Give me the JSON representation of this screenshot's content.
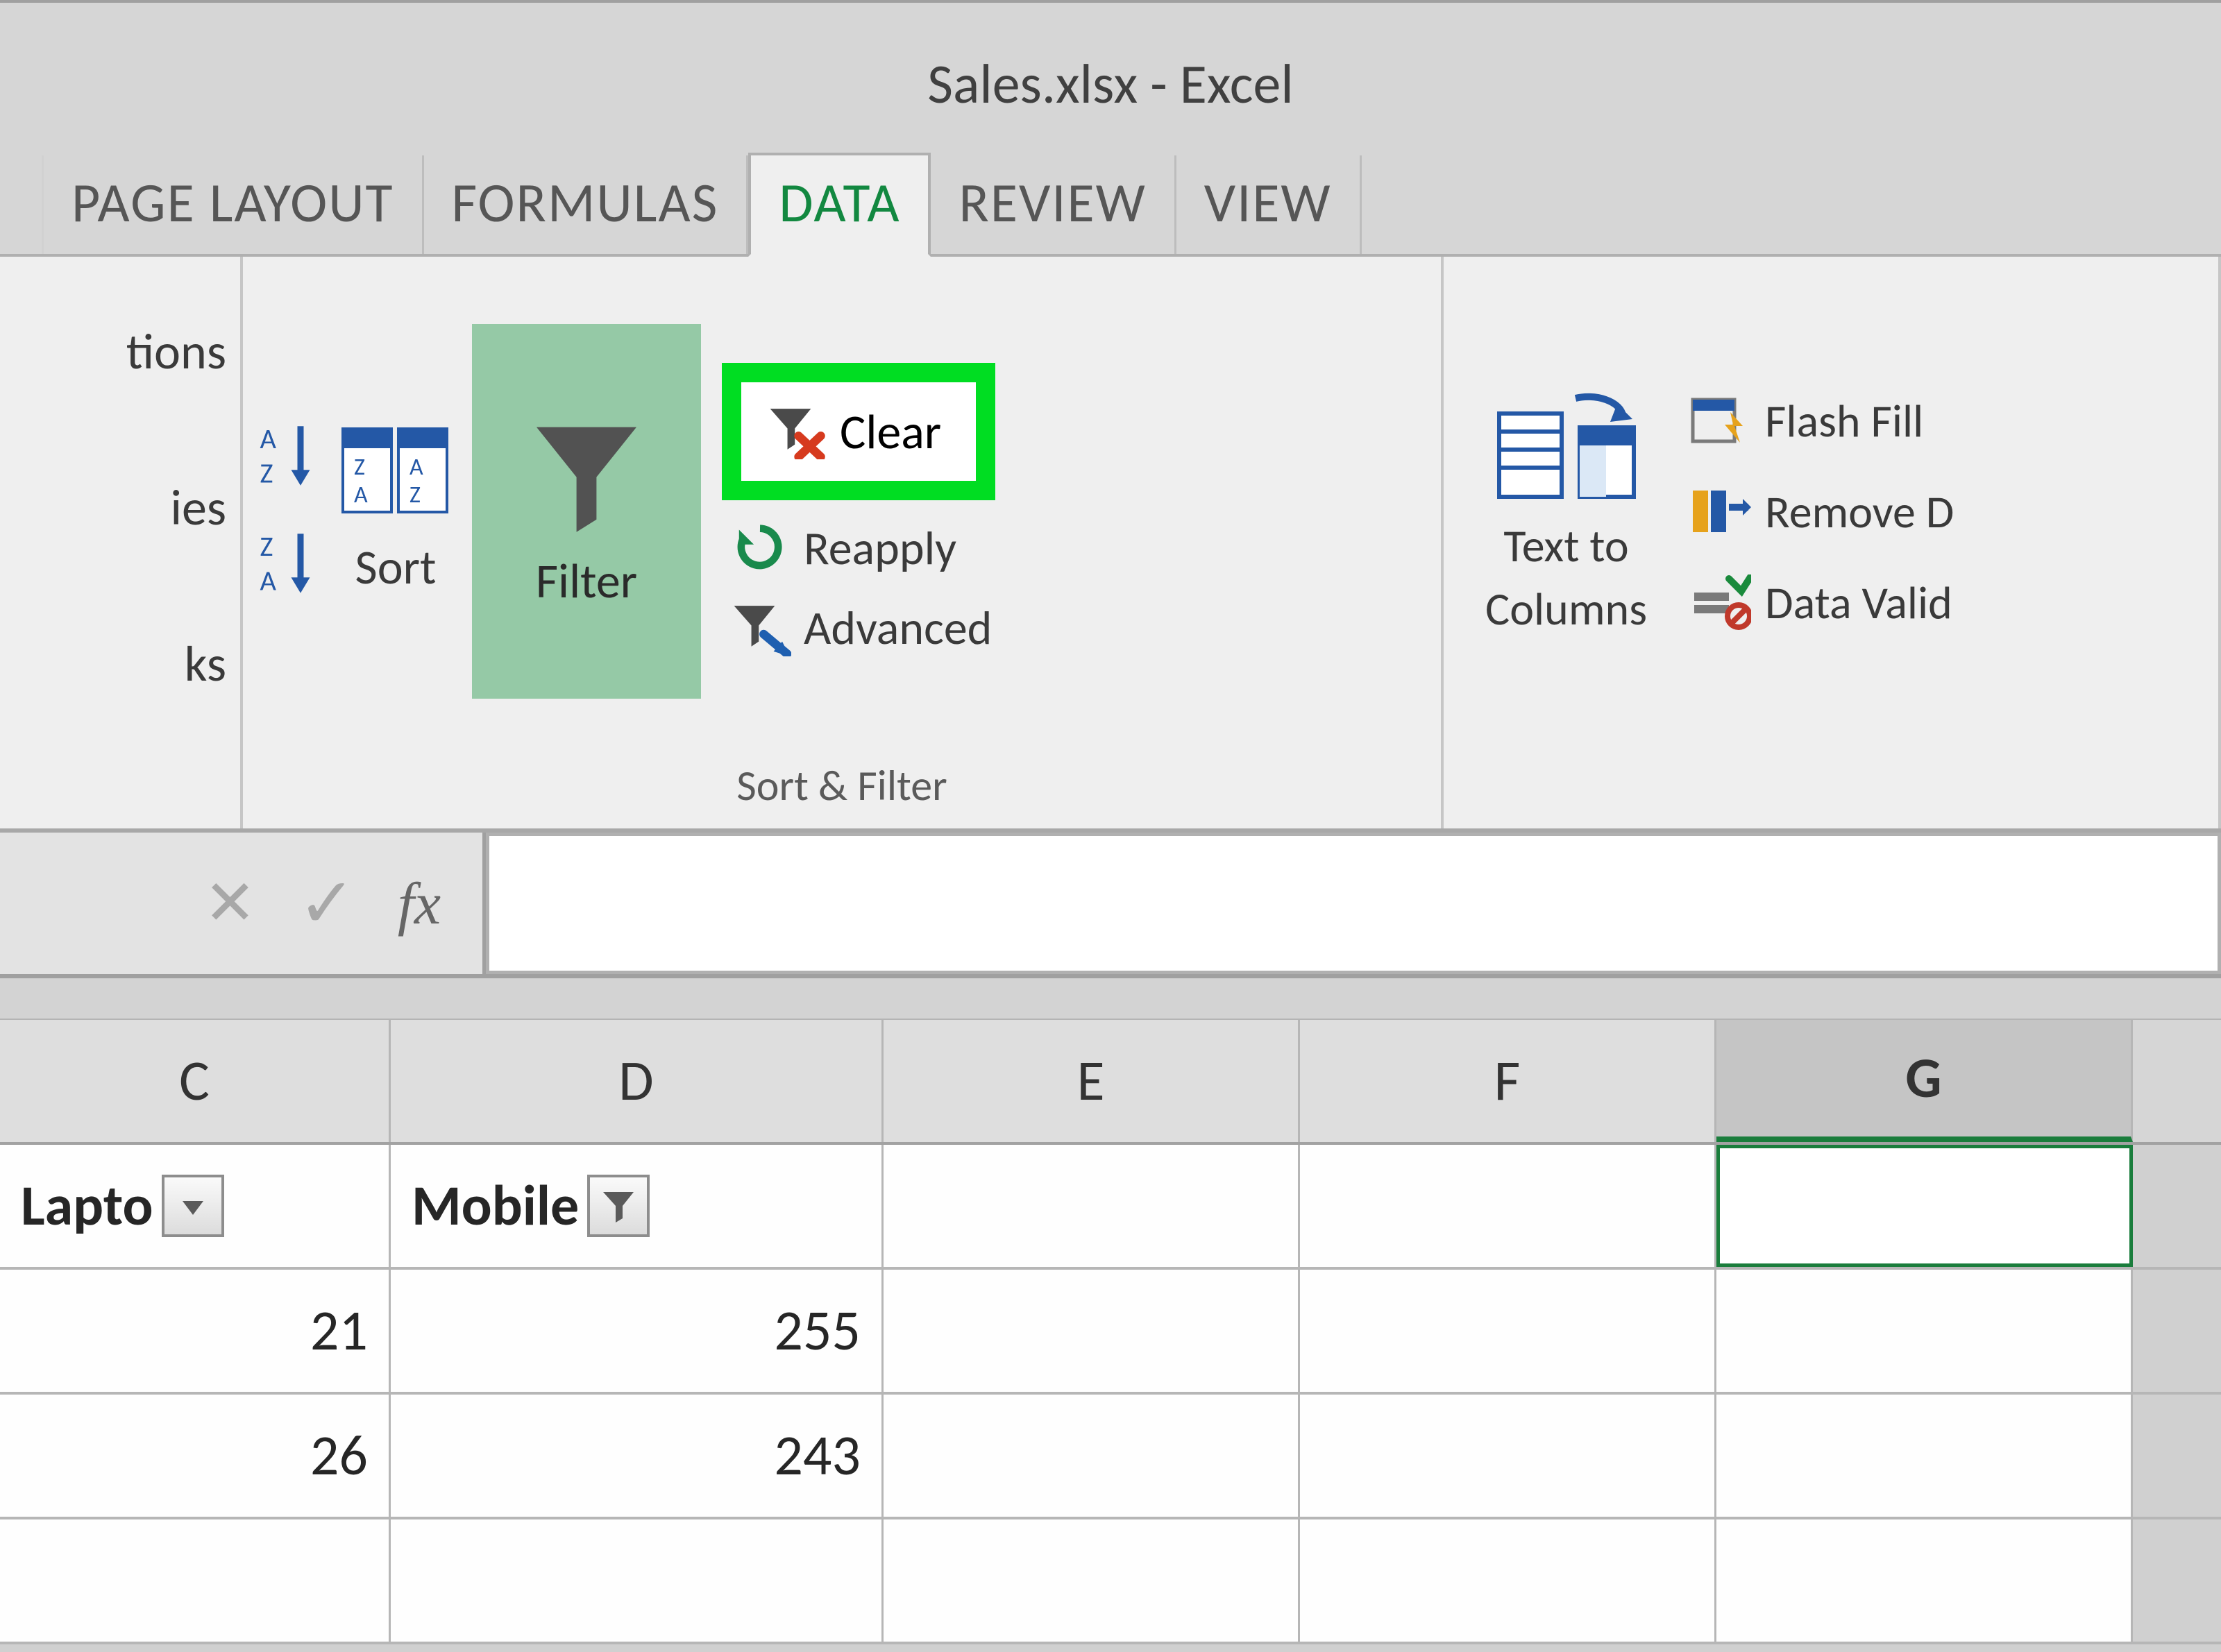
{
  "window_title": "Sales.xlsx - Excel",
  "tabs": {
    "page_layout": "PAGE LAYOUT",
    "formulas": "FORMULAS",
    "data": "DATA",
    "review": "REVIEW",
    "view": "VIEW"
  },
  "ribbon": {
    "partial_left": {
      "frag1": "tions",
      "frag2": "ies",
      "frag3": "ks"
    },
    "sort_filter": {
      "sort_label": "Sort",
      "filter_label": "Filter",
      "clear_label": "Clear",
      "reapply_label": "Reapply",
      "advanced_label": "Advanced",
      "group_label": "Sort & Filter"
    },
    "data_tools": {
      "text_to_columns_line1": "Text to",
      "text_to_columns_line2": "Columns",
      "flash_fill": "Flash Fill",
      "remove_dup": "Remove D",
      "data_valid": "Data Valid"
    }
  },
  "formula_bar": {
    "fx": "fx",
    "value": ""
  },
  "columns": {
    "C": "C",
    "D": "D",
    "E": "E",
    "F": "F",
    "G": "G"
  },
  "headers": {
    "C": "Lapto",
    "D": "Mobile"
  },
  "rows": [
    {
      "C": "21",
      "D": "255"
    },
    {
      "C": "26",
      "D": "243"
    }
  ]
}
